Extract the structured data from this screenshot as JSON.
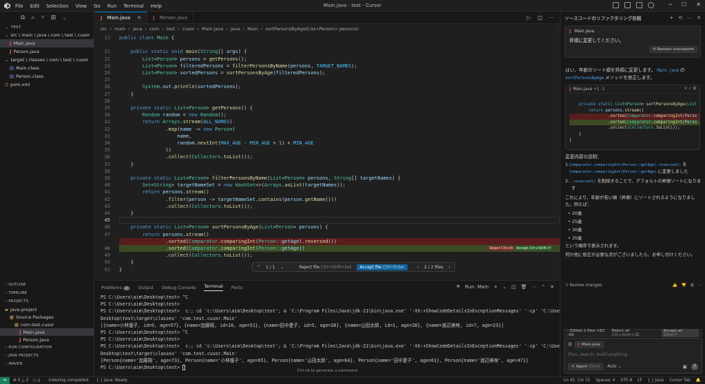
{
  "app": {
    "window_title": "Main.java - test - Cursor",
    "menu": [
      "File",
      "Edit",
      "Selection",
      "View",
      "Go",
      "Run",
      "Terminal",
      "Help"
    ]
  },
  "explorer": {
    "section": "TEST",
    "tree": [
      {
        "label": "src \\ main \\ java \\ com \\ test \\ cusor",
        "indent": 1,
        "type": "folder"
      },
      {
        "label": "Main.java",
        "indent": 2,
        "type": "java",
        "selected": true
      },
      {
        "label": "Person.java",
        "indent": 2,
        "type": "java"
      },
      {
        "label": "target \\ classes \\ com \\ test \\ cusor",
        "indent": 1,
        "type": "folder"
      },
      {
        "label": "Main.class",
        "indent": 2,
        "type": "class"
      },
      {
        "label": "Person.class",
        "indent": 2,
        "type": "class"
      },
      {
        "label": "pom.xml",
        "indent": 1,
        "type": "xml"
      }
    ],
    "bottom_sections": [
      "OUTLINE",
      "TIMELINE",
      "PROJECTS"
    ],
    "projects": [
      {
        "label": "java-project",
        "indent": 1
      },
      {
        "label": "Source Packages",
        "indent": 2
      },
      {
        "label": "com.test.cusor",
        "indent": 3
      },
      {
        "label": "Main.java",
        "indent": 4,
        "selected": true
      },
      {
        "label": "Person.java",
        "indent": 4
      }
    ],
    "more_sections": [
      "RUN CONFIGURATION",
      "JAVA PROJECTS",
      "MAVEN"
    ]
  },
  "editor": {
    "tabs": [
      {
        "label": "Main.java",
        "active": true
      },
      {
        "label": "Person.java",
        "active": false
      }
    ],
    "breadcrumb": [
      "src",
      "main",
      "java",
      "com",
      "test",
      "cusor",
      "Main.java",
      "Java",
      "Main",
      "sortPersonsByAge(List<Person> persons)"
    ],
    "lines": [
      {
        "n": "11",
        "t": "public class Main {"
      },
      {
        "n": "",
        "t": ""
      },
      {
        "n": "21",
        "t": "    public static void main(String[] args) {"
      },
      {
        "n": "22",
        "t": "        List<Person> persons = getPersons();"
      },
      {
        "n": "23",
        "t": "        List<Person> filteredPersons = filterPersonsByName(persons, TARGET_NAMES);"
      },
      {
        "n": "24",
        "t": "        List<Person> sortedPersons = sortPersonsByAge(filteredPersons);"
      },
      {
        "n": "25",
        "t": ""
      },
      {
        "n": "26",
        "t": "        System.out.println(sortedPersons);"
      },
      {
        "n": "27",
        "t": "    }"
      },
      {
        "n": "28",
        "t": ""
      },
      {
        "n": "29",
        "t": "    private static List<Person> getPersons() {"
      },
      {
        "n": "30",
        "t": "        Random random = new Random();"
      },
      {
        "n": "31",
        "t": "        return Arrays.stream(ALL_NAMES)"
      },
      {
        "n": "32",
        "t": "                .map(name -> new Person("
      },
      {
        "n": "33",
        "t": "                    name,"
      },
      {
        "n": "34",
        "t": "                    random.nextInt(MAX_AGE - MIN_AGE + 1) + MIN_AGE"
      },
      {
        "n": "35",
        "t": "                ))"
      },
      {
        "n": "36",
        "t": "                .collect(Collectors.toList());"
      },
      {
        "n": "37",
        "t": "    }"
      },
      {
        "n": "38",
        "t": ""
      },
      {
        "n": "39",
        "t": "    private static List<Person> filterPersonsByName(List<Person> persons, String[] targetNames) {"
      },
      {
        "n": "40",
        "t": "        Set<String> targetNameSet = new HashSet<>(Arrays.asList(targetNames));"
      },
      {
        "n": "41",
        "t": "        return persons.stream()"
      },
      {
        "n": "42",
        "t": "                .filter(person -> targetNameSet.contains(person.getName()))"
      },
      {
        "n": "43",
        "t": "                .collect(Collectors.toList());"
      },
      {
        "n": "44",
        "t": "    }"
      },
      {
        "n": "45",
        "t": ""
      },
      {
        "n": "46",
        "t": "    private static List<Person> sortPersonsByAge(List<Person> persons) {"
      },
      {
        "n": "47",
        "t": "        return persons.stream()"
      },
      {
        "n": "",
        "t": "                .sorted(Comparator.comparingInt(Person::getAge).reversed())",
        "diff": "del"
      },
      {
        "n": "48",
        "t": "                .sorted(Comparator.comparingInt(Person::getAge))",
        "diff": "add"
      },
      {
        "n": "49",
        "t": "                .collect(Collectors.toList());"
      },
      {
        "n": "50",
        "t": "    }"
      },
      {
        "n": "51",
        "t": "}"
      }
    ],
    "reject_hint": "Reject Ctrl+N",
    "accept_hint": "Accept Ctrl+Shift+Y",
    "diff_toolbar": {
      "nav": "1 / 1",
      "reject": "Reject file",
      "reject_key": "Ctrl+Shift+Del",
      "accept": "Accept file",
      "accept_key": "Ctrl+Enter",
      "files": "2 / 2 files"
    }
  },
  "panel": {
    "tabs": [
      "Problems",
      "Output",
      "Debug Console",
      "Terminal",
      "Ports"
    ],
    "problems_count": "2",
    "active": "Terminal",
    "run_label": "Run: Main",
    "terminal_lines": [
      "PS C:\\Users\\aim\\Desktop\\test> ^C",
      "PS C:\\Users\\aim\\Desktop\\test>",
      "PS C:\\Users\\aim\\Desktop\\test>  c:; cd 'c:\\Users\\aim\\Desktop\\test'; & 'C:\\Program Files\\Java\\jdk-21\\bin\\java.exe' '-XX:+ShowCodeDetailsInExceptionMessages' '-cp' 'C:\\Users\\aim\\",
      "Desktop\\test\\target\\classes' 'com.test.cusor.Main'",
      "[{name=小林優子, id=9, age=57}, {name=加藤翔, id=10, age=51}, {name=田中愛子, id=5, age=30}, {name=山田太郎, id=1, age=28}, {name=渡辺美咲, id=7, age=23}]",
      "PS C:\\Users\\aim\\Desktop\\test> ^C",
      "PS C:\\Users\\aim\\Desktop\\test>",
      "PS C:\\Users\\aim\\Desktop\\test>  c:; cd 'c:\\Users\\aim\\Desktop\\test'; & 'C:\\Program Files\\Java\\jdk-21\\bin\\java.exe' '-XX:+ShowCodeDetailsInExceptionMessages' '-cp' 'C:\\Users\\aim\\",
      "Desktop\\test\\target\\classes' 'com.test.cusor.Main'",
      "[Person{name='加藤翔', age=73}, Person{name='小林優子', age=65}, Person{name='山田太郎', age=64}, Person{name='田中愛子', age=61}, Person{name='渡辺美咲', age=47}]",
      "PS C:\\Users\\aim\\Desktop\\test> "
    ],
    "hint": "Ctrl+K to generate a command"
  },
  "chat": {
    "title": "ソースコードのリファクタリング依頼",
    "user_file": "Main.java",
    "user_msg": "昇順に変更してください。",
    "restore": "Restore checkpoint",
    "reply_intro_a": "はい、年齢のソート順を昇順に変更します。",
    "reply_file": "Main.java",
    "reply_intro_b": "の",
    "reply_method": "sortPersonsByAge",
    "reply_intro_c": "メソッドを修正します。",
    "card_file": "Main.java",
    "card_stat": "+1 -1",
    "card_lines": [
      {
        "t": "    private static List<Person> sortPersonsByAge(List",
        "d": ""
      },
      {
        "t": "        return persons.stream()",
        "d": ""
      },
      {
        "t": "                .sorted(Comparator.comparingInt(Perso",
        "d": "del"
      },
      {
        "t": "                .sorted(Comparator.comparingInt(Perso",
        "d": "add"
      },
      {
        "t": "                .collect(Collectors.toList());",
        "d": ""
      },
      {
        "t": "    }",
        "d": ""
      },
      {
        "t": "}",
        "d": ""
      }
    ],
    "changes_title": "変更内容の説明：",
    "item1_code_a": "Comparator.comparingInt(Person::getAge).reversed()",
    "item1_text_a": "を",
    "item1_code_b": "Comparator.comparingInt(Person::getAge)",
    "item1_text_b": "に変更しました",
    "item2_code": ".reversed()",
    "item2_text": "を削除することで、デフォルトの昇順ソートになります",
    "summary": "これにより、年齢が若い順（昇順）にソートされるようになりました。例えば：",
    "ages": [
      "20歳",
      "25歳",
      "30歳",
      "35歳"
    ],
    "order_note": "という順序で表示されます。",
    "closing": "何か他に修正が必要な点がございましたら、お申し付けください。",
    "review": "Review changes",
    "edited": "Edited 2 files +82 -49",
    "reject_all": "Reject all",
    "reject_all_key": "Ctrl+Shift+⌫",
    "accept_all": "Accept all",
    "accept_all_key": "Ctrl+⏎",
    "input_file": "Main.java",
    "input_placeholder": "Plan, search, build anything",
    "agent": "Agent",
    "agent_key": "Ctrl+I",
    "model": "Auto"
  },
  "status": {
    "errors": "0",
    "warnings": "2",
    "info": "0",
    "indexing": "Indexing completed.",
    "java": "Java: Ready",
    "position": "Ln 45, Col 72",
    "spaces": "Spaces: 4",
    "encoding": "UTF-8",
    "eol": "LF",
    "lang": "Java",
    "tab": "Cursor Tab"
  }
}
